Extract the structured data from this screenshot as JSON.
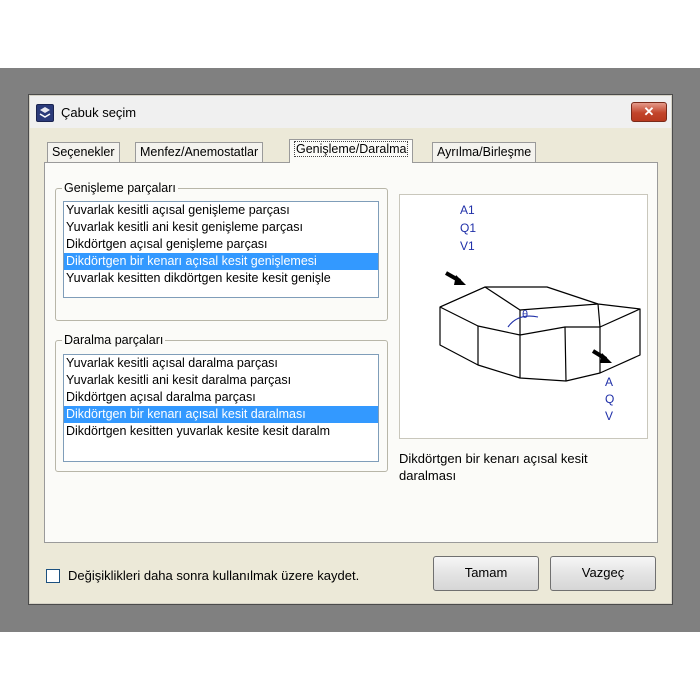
{
  "window": {
    "title": "Çabuk seçim",
    "close_label": "✕"
  },
  "tabs": [
    {
      "label": "Seçenekler"
    },
    {
      "label": "Menfez/Anemostatlar"
    },
    {
      "label": "Genişleme/Daralma"
    },
    {
      "label": "Ayrılma/Birleşme"
    }
  ],
  "expansion_group": {
    "label": "Genişleme parçaları",
    "items": [
      "Yuvarlak kesitli açısal genişleme parçası",
      "Yuvarlak kesitli ani kesit genişleme parçası",
      "Dikdörtgen açısal genişleme parçası",
      "Dikdörtgen bir kenarı açısal kesit genişlemesi",
      "Yuvarlak kesitten dikdörtgen kesite kesit genişle"
    ],
    "selected_index": 3
  },
  "contraction_group": {
    "label": "Daralma parçaları",
    "items": [
      "Yuvarlak kesitli açısal daralma parçası",
      "Yuvarlak kesitli ani kesit daralma parçası",
      "Dikdörtgen açısal daralma parçası",
      "Dikdörtgen bir kenarı açısal kesit daralması",
      "Dikdörtgen kesitten yuvarlak kesite kesit daralm"
    ],
    "selected_index": 3
  },
  "preview": {
    "inlet_labels": [
      "A1",
      "Q1",
      "V1"
    ],
    "outlet_labels": [
      "A",
      "Q",
      "V"
    ],
    "angle_label": "θ",
    "caption": "Dikdörtgen bir kenarı açısal kesit daralması"
  },
  "footer": {
    "checkbox_label": "Değişiklikleri daha sonra kullanılmak üzere kaydet.",
    "checkbox_checked": false,
    "ok_label": "Tamam",
    "cancel_label": "Vazgeç"
  },
  "colors": {
    "selection": "#3399ff",
    "label_blue": "#1f2fa8"
  }
}
